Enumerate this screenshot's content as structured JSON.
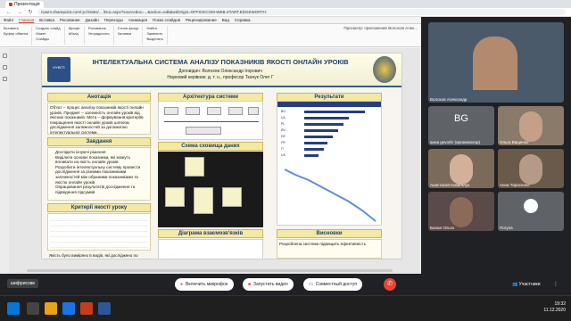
{
  "browser": {
    "tab_title": "Презентація",
    "url": "nuwm.sharepoint.com/:p:/r/sites/... /Doc.aspx?sourcedoc=...&action=edit&wdOrigin=OFFICECOM-WEB.START.EDGEWORTH",
    "back": "←",
    "forward": "→",
    "reload": "↻"
  },
  "ppt": {
    "ribbon_tabs": [
      "Файл",
      "Главная",
      "Вставка",
      "Рисование",
      "Дизайн",
      "Переходы",
      "Анимация",
      "Показ слайдов",
      "Рецензирование",
      "Вид",
      "Справка"
    ],
    "active_tab_index": 1,
    "collab_label": "Просмотр: приложение Волохов Алек...",
    "ribbon_groups": [
      [
        "Вставить",
        "Буфер обмена"
      ],
      [
        "Создать слайд",
        "Макет",
        "Слайды"
      ],
      [
        "Шрифт",
        "Абзац"
      ],
      [
        "Рисование",
        "Упорядочить"
      ],
      [
        "Стили фигур",
        "Заливка"
      ],
      [
        "Найти",
        "Заменить",
        "Выделить"
      ]
    ]
  },
  "slide": {
    "title": "ІНТЕЛЕКТУАЛЬНА СИСТЕМА АНАЛІЗУ ПОКАЗНИКІВ ЯКОСТІ ОНЛАЙН УРОКІВ",
    "author": "Доповідач: Волохов Олександр Ігорович",
    "advisor": "Науковий керівник: д. т. н., професор Ткачук Олег Г",
    "logo_left_text": "НУВГП",
    "sections": {
      "annotation": {
        "header": "Анотація",
        "body": "Об'єкт – процес аналізу показників якості онлайн уроків. Предмет – залежність онлайн уроків від якісних показників. Мета – формування критеріїв покращення якості онлайн уроків шляхом дослідження залежностей за допомогою інтелектуальної системи."
      },
      "tasks": {
        "header": "Завдання",
        "items": [
          "Дослідити існуючі рішення",
          "Виділити основні показники, які можуть впливати на якість онлайн уроків",
          "Розробити інтелектуальну систему провести дослідження за різними показниками залежностей між обраними показниками та якістю онлайн уроків",
          "Опрацювання результатів дослідження та підведення підсумків"
        ]
      },
      "criteria": {
        "header": "Критерії якості уроку",
        "footer": "Якість було виміряно 6 видів, які досліджено по"
      },
      "architecture": {
        "header": "Архітектура системи"
      },
      "db_schema": {
        "header": "Схема сховища даних"
      },
      "interaction": {
        "header": "Діаграма взаємозв'язків"
      },
      "results": {
        "header": "Результати"
      },
      "conclusions": {
        "header": "Висновки",
        "body": "Розроблена система підвищить ефективність"
      }
    },
    "result_bars": [
      {
        "label": "BG",
        "value": 0.85
      },
      {
        "label": "UA",
        "value": 0.62
      },
      {
        "label": "PL",
        "value": 0.55
      },
      {
        "label": "RU",
        "value": 0.47
      },
      {
        "label": "DE",
        "value": 0.4
      },
      {
        "label": "FR",
        "value": 0.33
      },
      {
        "label": "IT",
        "value": 0.27
      },
      {
        "label": "US",
        "value": 0.2
      }
    ]
  },
  "meeting": {
    "participants": [
      {
        "name": "Волохов Александр",
        "initials": "",
        "color": "#4a5a6a"
      },
      {
        "name": "анна gevorkr (организатор)",
        "initials": "BG",
        "color": "#5f6368"
      },
      {
        "name": "Ольга Ващенко",
        "initials": "",
        "color": "#8a7a6a"
      },
      {
        "name": "Анастасия Ковальчук",
        "initials": "",
        "color": "#7a6a5a"
      },
      {
        "name": "Анна Тарасенко",
        "initials": "",
        "color": "#6a5a4a"
      },
      {
        "name": "Балан Ольга",
        "initials": "",
        "color": "#5a4a4a"
      },
      {
        "name": "Погула",
        "initials": "",
        "color": "#5f6368"
      }
    ],
    "participants_label": "Участники",
    "more_label": "⋮"
  },
  "controls": {
    "mic_label": "Включить микрофон",
    "video_label": "Запустить видео",
    "share_label": "Совместный доступ",
    "hangup_label": "✆",
    "notice": "шифрисове"
  },
  "taskbar": {
    "time": "19:32",
    "date": "11.12.2020"
  }
}
